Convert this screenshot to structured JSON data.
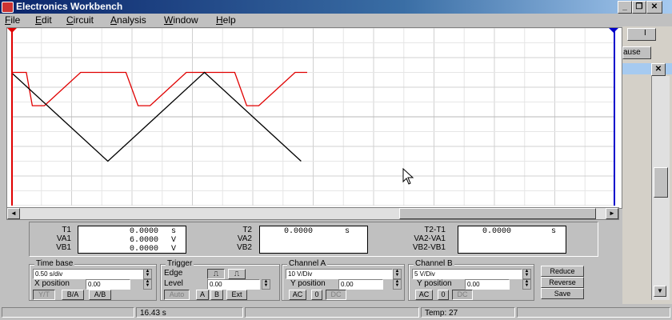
{
  "window": {
    "title": "Electronics Workbench"
  },
  "menu": [
    {
      "label": "File"
    },
    {
      "label": "Edit"
    },
    {
      "label": "Circuit"
    },
    {
      "label": "Analysis"
    },
    {
      "label": "Window"
    },
    {
      "label": "Help"
    }
  ],
  "side": {
    "pause_label": "ause"
  },
  "readouts": {
    "left": {
      "rows": [
        {
          "label": "T1",
          "value": "0.0000",
          "unit": "s"
        },
        {
          "label": "VA1",
          "value": "6.0000",
          "unit": "V"
        },
        {
          "label": "VB1",
          "value": "0.0000",
          "unit": "V"
        }
      ]
    },
    "middle": {
      "labels": [
        "T2",
        "VA2",
        "VB2"
      ],
      "value": "0.0000",
      "unit": "s"
    },
    "right": {
      "labels": [
        "T2-T1",
        "VA2-VA1",
        "VB2-VB1"
      ],
      "value": "0.0000",
      "unit": "s"
    }
  },
  "timebase": {
    "title": "Time base",
    "value": "0.50 s/div",
    "xpos_label": "X position",
    "xpos_value": "0.00",
    "buttons": [
      "Y/T",
      "B/A",
      "A/B"
    ]
  },
  "trigger": {
    "title": "Trigger",
    "edge_label": "Edge",
    "level_label": "Level",
    "level_value": "0.00",
    "buttons": [
      "Auto",
      "A",
      "B",
      "Ext"
    ]
  },
  "channel_a": {
    "title": "Channel A",
    "value": "10 V/Div",
    "ypos_label": "Y position",
    "ypos_value": "0.00",
    "coupling": [
      "AC",
      "0",
      "DC"
    ]
  },
  "channel_b": {
    "title": "Channel B",
    "value": "5 V/Div",
    "ypos_label": "Y position",
    "ypos_value": "0.00",
    "coupling": [
      "AC",
      "0",
      "DC"
    ]
  },
  "actions": {
    "reduce": "Reduce",
    "reverse": "Reverse",
    "save": "Save"
  },
  "status": {
    "time": "16.43 s",
    "temp": "Temp:  27"
  },
  "colors": {
    "channel_a": "#000000",
    "channel_b": "#e00000",
    "cursor": "#0000cc"
  },
  "trace": {
    "y_range": [
      -2,
      2
    ],
    "time_range_div": [
      0,
      10
    ],
    "channel_a": {
      "t": [
        0,
        0.8,
        1.6,
        2.4,
        3.2,
        4.0,
        4.8
      ],
      "v": [
        1,
        0,
        -1,
        0,
        1,
        0,
        -1
      ]
    },
    "channel_b": {
      "t": [
        0,
        0.25,
        0.35,
        0.55,
        1.15,
        1.35,
        1.55,
        1.9,
        2.1,
        2.3,
        2.9,
        3.1,
        3.3,
        3.7,
        3.9,
        4.1,
        4.7,
        4.9
      ],
      "v": [
        1,
        1,
        0.25,
        0.25,
        1,
        1,
        1,
        1,
        0.25,
        0.25,
        1,
        1,
        1,
        1,
        0.25,
        0.25,
        1,
        1
      ]
    }
  }
}
